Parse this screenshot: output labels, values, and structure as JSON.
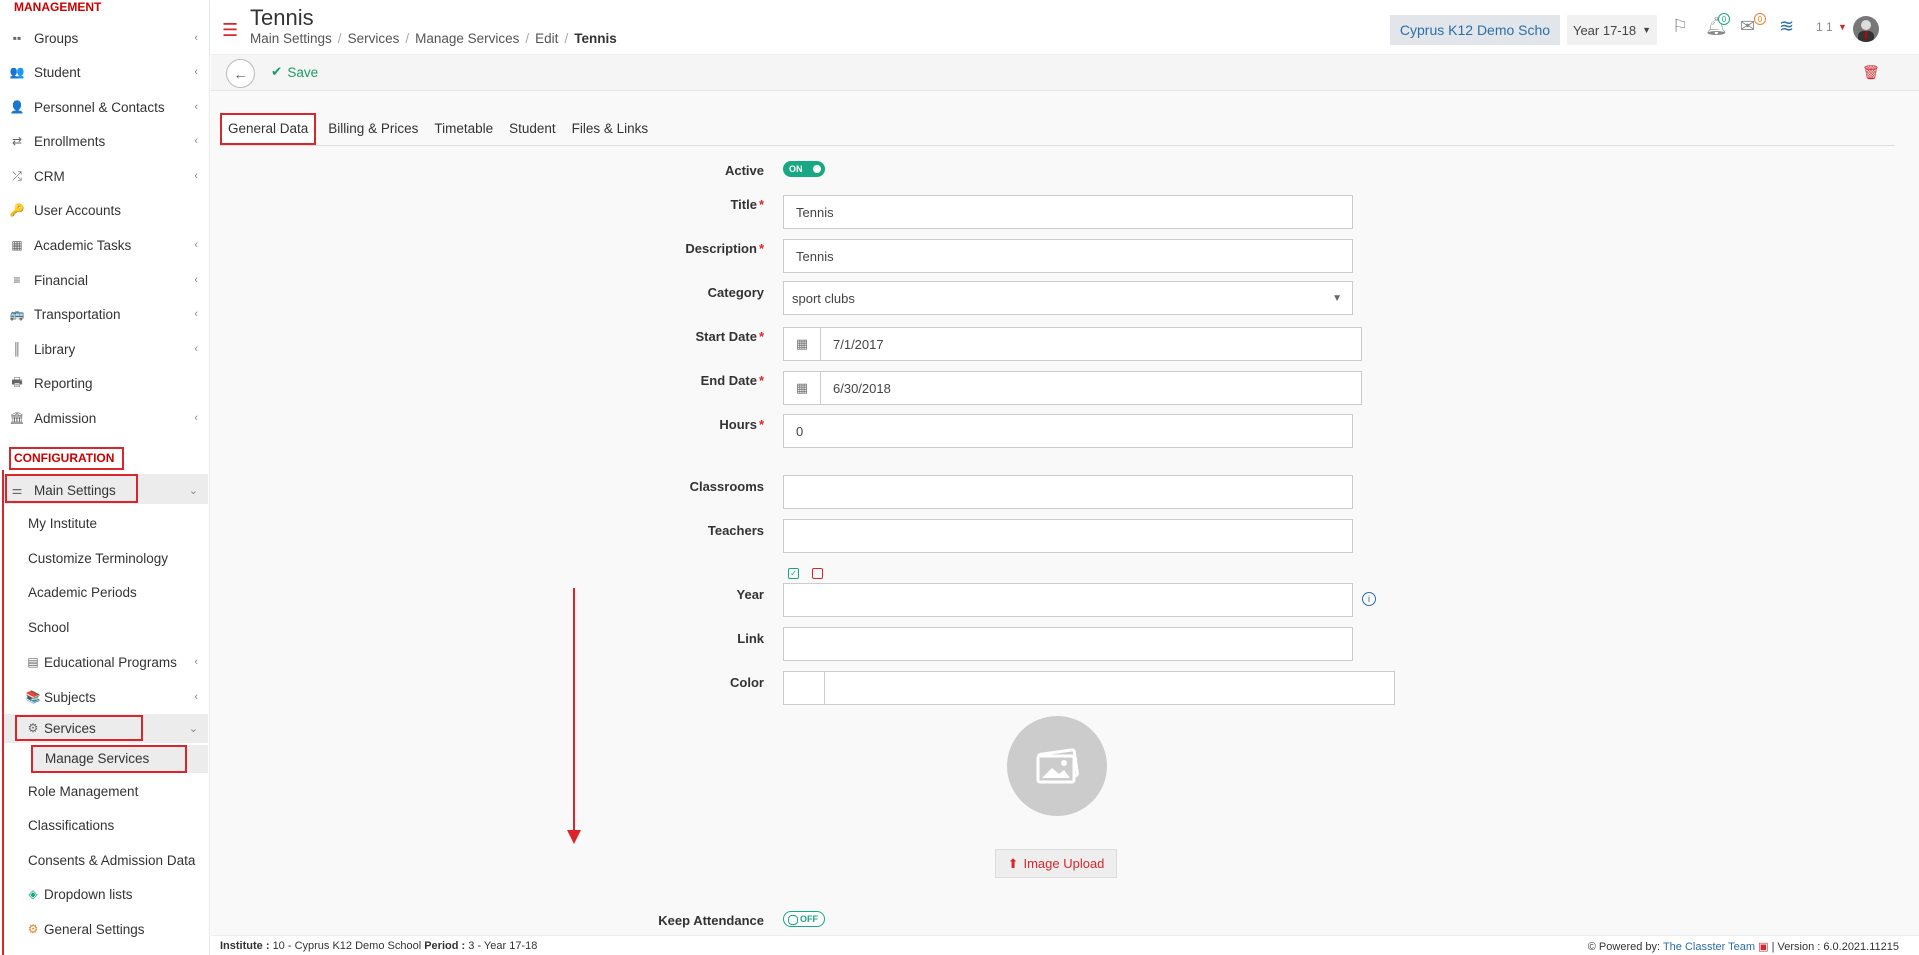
{
  "sidebar": {
    "management_label": "MANAGEMENT",
    "configuration_label": "CONFIGURATION",
    "items": [
      {
        "label": "Groups",
        "icon": "groups-icon"
      },
      {
        "label": "Student",
        "icon": "student-icon"
      },
      {
        "label": "Personnel & Contacts",
        "icon": "personnel-icon"
      },
      {
        "label": "Enrollments",
        "icon": "enrollments-icon"
      },
      {
        "label": "CRM",
        "icon": "crm-icon"
      },
      {
        "label": "User Accounts",
        "icon": "user-accounts-icon"
      },
      {
        "label": "Academic Tasks",
        "icon": "academic-tasks-icon"
      },
      {
        "label": "Financial",
        "icon": "financial-icon"
      },
      {
        "label": "Transportation",
        "icon": "transportation-icon"
      },
      {
        "label": "Library",
        "icon": "library-icon"
      },
      {
        "label": "Reporting",
        "icon": "reporting-icon"
      },
      {
        "label": "Admission",
        "icon": "admission-icon"
      }
    ],
    "main_settings": "Main Settings",
    "sub": {
      "my_institute": "My Institute",
      "customize_terminology": "Customize Terminology",
      "academic_periods": "Academic Periods",
      "school": "School",
      "educational_programs": "Educational Programs",
      "subjects": "Subjects",
      "services": "Services",
      "manage_services": "Manage Services",
      "role_management": "Role Management",
      "classifications": "Classifications",
      "consents": "Consents & Admission Data",
      "dropdown_lists": "Dropdown lists",
      "general_settings": "General Settings"
    }
  },
  "header": {
    "title": "Tennis",
    "breadcrumb": [
      "Main Settings",
      "Services",
      "Manage Services",
      "Edit",
      "Tennis"
    ],
    "institute": "Cyprus K12 Demo Scho",
    "year": "Year 17-18",
    "notifications_count": "0",
    "messages_count": "0",
    "user_num": "1 1"
  },
  "toolbar": {
    "save_label": "Save"
  },
  "tabs": [
    "General Data",
    "Billing & Prices",
    "Timetable",
    "Student",
    "Files & Links"
  ],
  "form": {
    "active_label": "Active",
    "active_toggle": "ON",
    "title_label": "Title",
    "title_value": "Tennis",
    "description_label": "Description",
    "description_value": "Tennis",
    "category_label": "Category",
    "category_value": "sport clubs",
    "start_date_label": "Start Date",
    "start_date_value": "7/1/2017",
    "end_date_label": "End Date",
    "end_date_value": "6/30/2018",
    "hours_label": "Hours",
    "hours_value": "0",
    "classrooms_label": "Classrooms",
    "teachers_label": "Teachers",
    "year_label": "Year",
    "link_label": "Link",
    "color_label": "Color",
    "image_upload_label": "Image Upload",
    "keep_attendance_label": "Keep Attendance",
    "keep_attendance_toggle": "OFF"
  },
  "footer": {
    "institute_label": "Institute :",
    "institute_value": "10 - Cyprus K12 Demo School",
    "period_label": "Period :",
    "period_value": "3 - Year 17-18",
    "powered_by": "Powered by:",
    "team": "The Classter Team",
    "version": "| Version : 6.0.2021.11215"
  },
  "colors": {
    "accent_red": "#d9262c",
    "green": "#1aa784",
    "link_blue": "#2a6fa8"
  }
}
